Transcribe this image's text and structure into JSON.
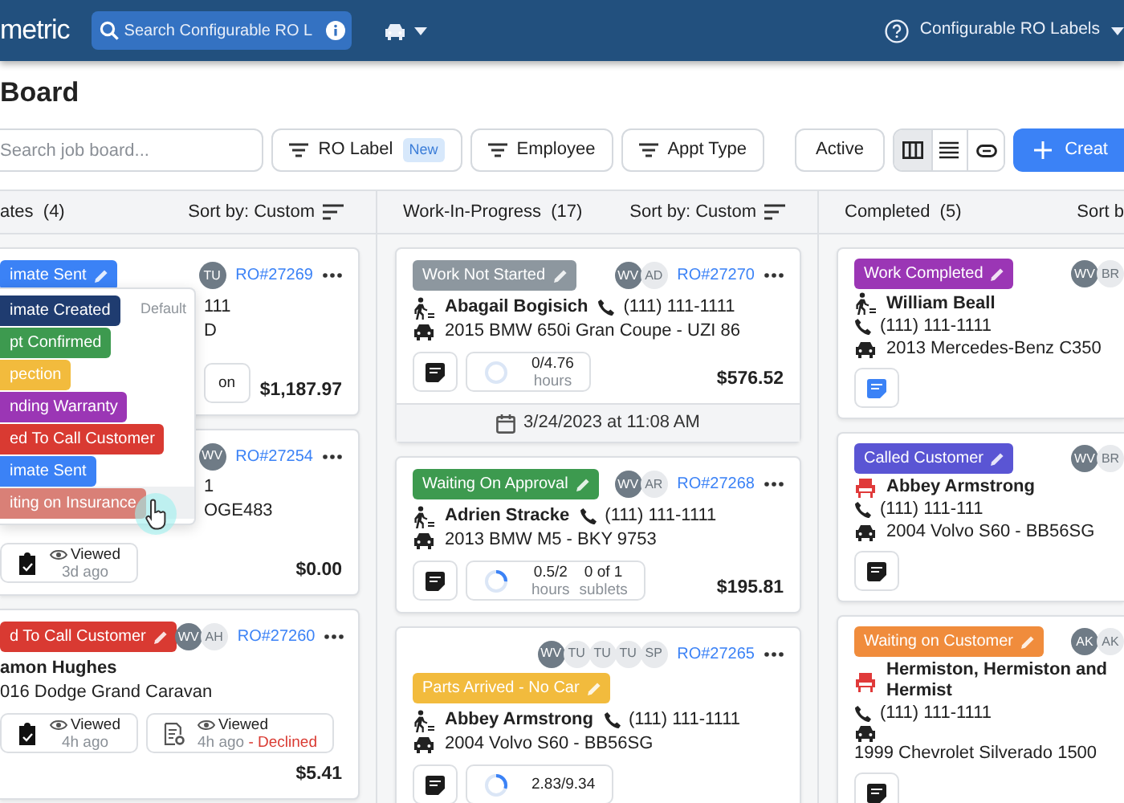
{
  "navbar": {
    "logo": "metric",
    "search": {
      "placeholder": "Search Configurable RO L"
    },
    "account": "Configurable RO Labels"
  },
  "page_title": "Board",
  "toolbar": {
    "search": {
      "placeholder": "Search job board..."
    },
    "filters": [
      {
        "label": "RO Label",
        "badge": "New"
      },
      {
        "label": "Employee"
      },
      {
        "label": "Appt Type"
      }
    ],
    "status_filter": "Active",
    "views": [
      {
        "kind": "columns",
        "selected": true
      },
      {
        "kind": "list",
        "selected": false
      },
      {
        "kind": "link",
        "selected": false
      }
    ],
    "create": "Creat"
  },
  "columns": [
    {
      "title": "ates",
      "count": "(4)",
      "sort": "Sort by: Custom",
      "cards": [
        {
          "badge": {
            "label": "imate Sent",
            "color": "#3b82f6"
          },
          "avatars": [
            {
              "initials": "TU",
              "kind": "dark"
            }
          ],
          "ro": "RO#27269",
          "customer": {
            "phone": "111"
          },
          "vehicle": "D",
          "actions": [
            {
              "kind": "text",
              "label": "on"
            }
          ],
          "price": "$1,187.97"
        },
        {
          "avatars": [
            {
              "initials": "WV",
              "kind": "dark"
            }
          ],
          "ro": "RO#27254",
          "customer": {
            "phone": "1"
          },
          "vehicle": "OGE483",
          "actions": [
            {
              "kind": "checklist",
              "label": "Viewed",
              "time": "3d ago"
            }
          ],
          "price": "$0.00"
        },
        {
          "badge": {
            "label": "d To Call Customer",
            "color": "#d93a32"
          },
          "avatars": [
            {
              "initials": "WV",
              "kind": "dark"
            },
            {
              "initials": "AH",
              "kind": "light"
            }
          ],
          "ro": "RO#27260",
          "customer": {
            "name": "amon Hughes"
          },
          "vehicle": "016 Dodge Grand Caravan",
          "actions": [
            {
              "kind": "checklist",
              "label": "Viewed",
              "time": "4h ago"
            },
            {
              "kind": "estimate",
              "label": "Viewed",
              "time": "4h ago",
              "declined": "- Declined"
            }
          ],
          "price": "$5.41"
        }
      ]
    },
    {
      "title": "Work-In-Progress",
      "count": "(17)",
      "sort": "Sort by: Custom",
      "cards": [
        {
          "badge": {
            "label": "Work Not Started",
            "color": "#8d979f"
          },
          "avatars": [
            {
              "initials": "WV",
              "kind": "dark"
            },
            {
              "initials": "AD",
              "kind": "light"
            }
          ],
          "ro": "RO#27270",
          "customer": {
            "kind": "walkin",
            "name": "Abagail Bogisich",
            "phone": "(111) 111-1111"
          },
          "vehicle": "2015 BMW 650i Gran Coupe - UZI 86",
          "actions": [
            {
              "kind": "note",
              "active": false
            },
            {
              "kind": "hours",
              "value": "0/4.76",
              "unit": "hours",
              "level": 0
            }
          ],
          "price": "$576.52",
          "date": "3/24/2023 at 11:08 AM"
        },
        {
          "badge": {
            "label": "Waiting On Approval",
            "color": "#3d9a4f"
          },
          "avatars": [
            {
              "initials": "WV",
              "kind": "dark"
            },
            {
              "initials": "AR",
              "kind": "light"
            }
          ],
          "ro": "RO#27268",
          "customer": {
            "kind": "walkin",
            "name": "Adrien Stracke",
            "phone": "(111) 111-1111"
          },
          "vehicle": "2013 BMW M5 - BKY 9753",
          "actions": [
            {
              "kind": "note",
              "active": false
            },
            {
              "kind": "hours",
              "value": "0.5/2",
              "unit": "hours",
              "level": 0.25,
              "sublets": {
                "value": "0 of 1",
                "unit": "sublets"
              }
            }
          ],
          "price": "$195.81"
        },
        {
          "badge": {
            "label": "Parts Arrived - No Car",
            "color": "#f2bb3d"
          },
          "avatars": [
            {
              "initials": "WV",
              "kind": "dark"
            },
            {
              "initials": "TU",
              "kind": "light"
            },
            {
              "initials": "TU",
              "kind": "light"
            },
            {
              "initials": "TU",
              "kind": "light"
            },
            {
              "initials": "SP",
              "kind": "light"
            }
          ],
          "ro": "RO#27265",
          "customer": {
            "kind": "walkin",
            "name": "Abbey Armstrong",
            "phone": "(111) 111-1111"
          },
          "vehicle": "2004 Volvo S60 - BB56SG",
          "actions": [
            {
              "kind": "note",
              "active": false
            },
            {
              "kind": "hours",
              "value": "2.83/9.34",
              "level": 0.3
            }
          ]
        }
      ]
    },
    {
      "title": "Completed",
      "count": "(5)",
      "sort": "Sort b",
      "cards": [
        {
          "badge": {
            "label": "Work Completed",
            "color": "#9b36b5"
          },
          "avatars": [
            {
              "initials": "WV",
              "kind": "dark"
            },
            {
              "initials": "BR",
              "kind": "light"
            }
          ],
          "customer": {
            "kind": "walkin",
            "name": "William Beall",
            "phone": "(111) 111-1111"
          },
          "vehicle": "2013 Mercedes-Benz C350",
          "actions": [
            {
              "kind": "note",
              "active": true
            }
          ]
        },
        {
          "badge": {
            "label": "Called Customer",
            "color": "#5a55d4"
          },
          "avatars": [
            {
              "initials": "WV",
              "kind": "dark"
            },
            {
              "initials": "BR",
              "kind": "light"
            }
          ],
          "customer": {
            "kind": "waiter",
            "name": "Abbey Armstrong",
            "phone": "(111) 111-111"
          },
          "vehicle": "2004 Volvo S60 - BB56SG",
          "actions": [
            {
              "kind": "note",
              "active": false
            }
          ]
        },
        {
          "badge": {
            "label": "Waiting on Customer",
            "color": "#f08c3c"
          },
          "avatars": [
            {
              "initials": "AK",
              "kind": "dark"
            },
            {
              "initials": "AK",
              "kind": "light"
            }
          ],
          "customer": {
            "kind": "waiter",
            "name": "Hermiston, Hermiston and Hermist",
            "phone": "(111) 111-1111"
          },
          "vehicle": "1999 Chevrolet Silverado 1500",
          "actions": [
            {
              "kind": "note",
              "active": false
            }
          ]
        }
      ]
    }
  ],
  "status_menu": {
    "items": [
      {
        "label": "imate Created",
        "color": "#1f3c70",
        "hint": "Default",
        "hovered": false
      },
      {
        "label": "pt Confirmed",
        "color": "#3d9a4f",
        "hovered": false
      },
      {
        "label": "pection",
        "color": "#f2bb3d",
        "hovered": false
      },
      {
        "label": "nding Warranty",
        "color": "#9b36b5",
        "hovered": false
      },
      {
        "label": "ed To Call Customer",
        "color": "#d93a32",
        "hovered": false
      },
      {
        "label": "imate Sent",
        "color": "#3b82f6",
        "hovered": false
      },
      {
        "label": "iting on Insurance",
        "color": "#d98077",
        "hovered": true
      }
    ]
  }
}
